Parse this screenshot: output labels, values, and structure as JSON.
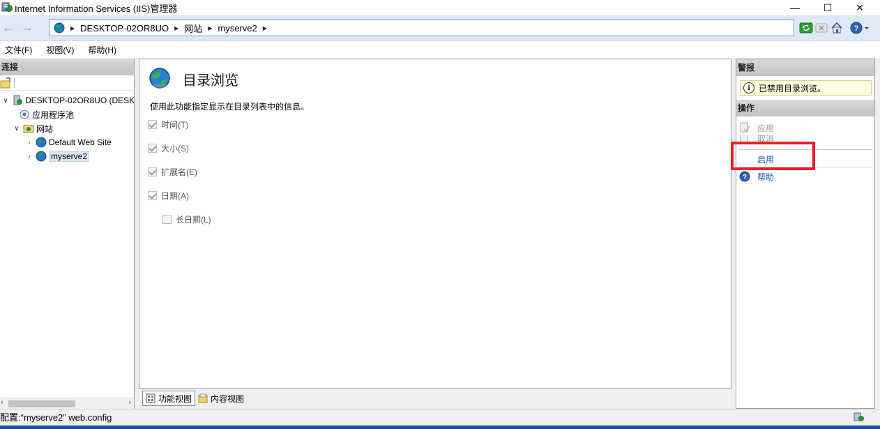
{
  "window": {
    "title": "Internet Information Services (IIS)管理器",
    "controls": {
      "minimize": "—",
      "maximize": "☐",
      "close": "✕"
    }
  },
  "address": {
    "crumbs": [
      "DESKTOP-02OR8UO",
      "网站",
      "myserve2"
    ],
    "separator": "▶"
  },
  "menu": {
    "items": [
      "文件(F)",
      "视图(V)",
      "帮助(H)"
    ]
  },
  "connections": {
    "header": "连接",
    "tree": {
      "server": "DESKTOP-02OR8UO (DESK",
      "app_pools": "应用程序池",
      "sites": "网站",
      "site_default": "Default Web Site",
      "site_selected": "myserve2"
    }
  },
  "feature": {
    "title": "目录浏览",
    "description": "使用此功能指定显示在目录列表中的信息。",
    "options": [
      {
        "label": "时间(T)",
        "checked": true
      },
      {
        "label": "大小(S)",
        "checked": true
      },
      {
        "label": "扩展名(E)",
        "checked": true
      },
      {
        "label": "日期(A)",
        "checked": true
      },
      {
        "label": "长日期(L)",
        "checked": false
      }
    ]
  },
  "view_tabs": {
    "features_view": "功能视图",
    "content_view": "内容视图"
  },
  "actions": {
    "alerts_header": "警报",
    "alert_text": "已禁用目录浏览。",
    "actions_header": "操作",
    "apply": "应用",
    "cancel": "取消",
    "enable": "启用",
    "help": "帮助"
  },
  "status": {
    "text": "配置:“myserve2” web.config"
  },
  "colors": {
    "highlight": "#e8202a",
    "link": "#1c57b8",
    "alert_bg": "#ffffe1"
  }
}
